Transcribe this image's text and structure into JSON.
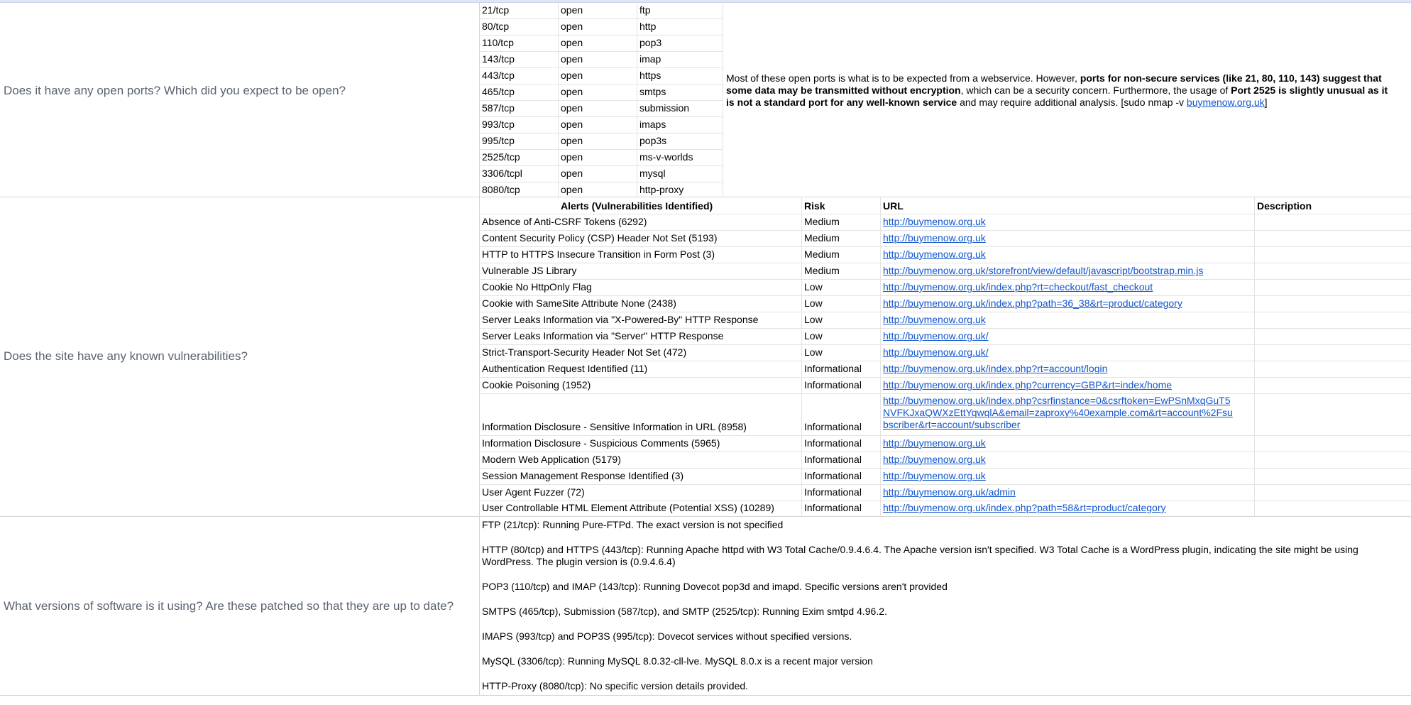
{
  "questions": {
    "ports": "Does it have any open ports? Which did you expect to be open?",
    "vulns": "Does the site have any known vulnerabilities?",
    "versions": "What versions of software is it using? Are these patched so that they are up to date?"
  },
  "ports": [
    {
      "port": "21/tcp",
      "state": "open",
      "service": "ftp"
    },
    {
      "port": "80/tcp",
      "state": "open",
      "service": "http"
    },
    {
      "port": "110/tcp",
      "state": "open",
      "service": "pop3"
    },
    {
      "port": "143/tcp",
      "state": "open",
      "service": "imap"
    },
    {
      "port": "443/tcp",
      "state": "open",
      "service": "https"
    },
    {
      "port": "465/tcp",
      "state": "open",
      "service": "smtps"
    },
    {
      "port": "587/tcp",
      "state": "open",
      "service": "submission"
    },
    {
      "port": "993/tcp",
      "state": "open",
      "service": "imaps"
    },
    {
      "port": "995/tcp",
      "state": "open",
      "service": "pop3s"
    },
    {
      "port": "2525/tcp",
      "state": "open",
      "service": "ms-v-worlds"
    },
    {
      "port": "3306/tcpl",
      "state": "open",
      "service": "mysql"
    },
    {
      "port": "8080/tcp",
      "state": "open",
      "service": "http-proxy"
    }
  ],
  "ports_answer": {
    "p1": "Most of these open ports is what is to be expected from a webservice. However, ",
    "b1": "ports for non-secure services (like 21, 80, 110, 143) suggest that some data may be transmitted without encryption",
    "p2": ", which can be a security concern. Furthermore, the usage of ",
    "b2": "Port 2525 is slightly unusual as it is not a standard port for any well-known service",
    "p3": " and may require additional analysis. [sudo nmap -v ",
    "link": "buymenow.org.uk",
    "p4": "]"
  },
  "alerts_headers": {
    "alert": "Alerts (Vulnerabilities Identified)",
    "risk": "Risk",
    "url": "URL",
    "description": "Description"
  },
  "alerts": [
    {
      "alert": "Absence of Anti-CSRF Tokens (6292)",
      "risk": "Medium",
      "url": "http://buymenow.org.uk"
    },
    {
      "alert": "Content Security Policy (CSP) Header Not Set (5193)",
      "risk": "Medium",
      "url": "http://buymenow.org.uk"
    },
    {
      "alert": "HTTP to HTTPS Insecure Transition in Form Post (3)",
      "risk": "Medium",
      "url": "http://buymenow.org.uk"
    },
    {
      "alert": "Vulnerable JS Library",
      "risk": "Medium",
      "url": "http://buymenow.org.uk/storefront/view/default/javascript/bootstrap.min.js"
    },
    {
      "alert": "Cookie No HttpOnly Flag",
      "risk": "Low",
      "url": "http://buymenow.org.uk/index.php?rt=checkout/fast_checkout"
    },
    {
      "alert": "Cookie with SameSite Attribute None (2438)",
      "risk": "Low",
      "url": "http://buymenow.org.uk/index.php?path=36_38&rt=product/category"
    },
    {
      "alert": "Server Leaks Information via \"X-Powered-By\" HTTP Response",
      "risk": "Low",
      "url": "http://buymenow.org.uk"
    },
    {
      "alert": "Server Leaks Information via \"Server\" HTTP Response",
      "risk": "Low",
      "url": "http://buymenow.org.uk/"
    },
    {
      "alert": "Strict-Transport-Security Header Not Set (472)",
      "risk": "Low",
      "url": "http://buymenow.org.uk/"
    },
    {
      "alert": "Authentication Request Identified (11)",
      "risk": "Informational",
      "url": "http://buymenow.org.uk/index.php?rt=account/login"
    },
    {
      "alert": "Cookie Poisoning (1952)",
      "risk": "Informational",
      "url": "http://buymenow.org.uk/index.php?currency=GBP&rt=index/home"
    },
    {
      "alert": "Information Disclosure - Sensitive Information in URL (8958)",
      "risk": "Informational",
      "url_lines": [
        "http://buymenow.org.uk/index.php?csrfinstance=0&csrftoken=EwPSnMxqGuT5",
        "NVFKJxaQWXzEttYqwqlA&email=zaproxy%40example.com&rt=account%2Fsu",
        "bscriber&rt=account/subscriber"
      ]
    },
    {
      "alert": "Information Disclosure - Suspicious Comments (5965)",
      "risk": "Informational",
      "url": "http://buymenow.org.uk"
    },
    {
      "alert": "Modern Web Application (5179)",
      "risk": "Informational",
      "url": "http://buymenow.org.uk"
    },
    {
      "alert": "Session Management Response Identified (3)",
      "risk": "Informational",
      "url": "http://buymenow.org.uk"
    },
    {
      "alert": "User Agent Fuzzer (72)",
      "risk": "Informational",
      "url": "http://buymenow.org.uk/admin"
    },
    {
      "alert": "User Controllable HTML Element Attribute (Potential XSS) (10289)",
      "risk": "Informational",
      "url": "http://buymenow.org.uk/index.php?path=58&rt=product/category"
    }
  ],
  "versions": [
    "FTP (21/tcp): Running Pure-FTPd. The exact version is not specified",
    "HTTP (80/tcp) and HTTPS (443/tcp): Running Apache httpd with W3 Total Cache/0.9.4.6.4. The Apache version isn't specified. W3 Total Cache is a WordPress plugin, indicating the site might be using WordPress. The plugin version is (0.9.4.6.4)",
    "POP3 (110/tcp) and IMAP (143/tcp): Running Dovecot pop3d and imapd. Specific versions aren't provided",
    "SMTPS (465/tcp), Submission (587/tcp), and SMTP (2525/tcp): Running Exim smtpd 4.96.2.",
    "IMAPS (993/tcp) and POP3S (995/tcp): Dovecot services without specified versions.",
    "MySQL (3306/tcp): Running MySQL 8.0.32-cll-lve. MySQL 8.0.x is a recent major version",
    "HTTP-Proxy (8080/tcp): No specific version details provided."
  ],
  "colors": {
    "link": "#1155cc",
    "question": "#5a6270",
    "gridline": "#d6d6d6"
  }
}
